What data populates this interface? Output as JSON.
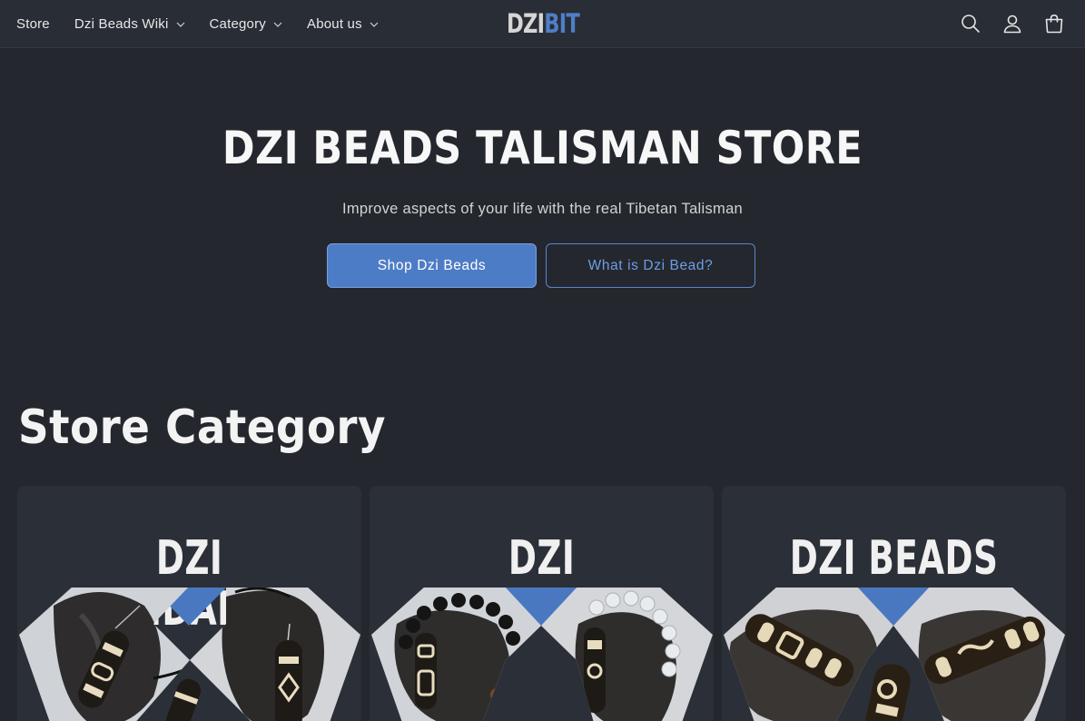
{
  "header": {
    "nav": [
      {
        "label": "Store",
        "has_dropdown": false
      },
      {
        "label": "Dzi Beads Wiki",
        "has_dropdown": true
      },
      {
        "label": "Category",
        "has_dropdown": true
      },
      {
        "label": "About us",
        "has_dropdown": true
      }
    ],
    "logo": {
      "part1": "DZI",
      "part2": "BIT"
    },
    "icons": [
      "search-icon",
      "account-icon",
      "cart-icon"
    ]
  },
  "hero": {
    "title": "DZI BEADS TALISMAN STORE",
    "subtitle": "Improve aspects of your life with the real Tibetan Talisman",
    "primary_button": "Shop Dzi Beads",
    "secondary_button": "What is Dzi Bead?"
  },
  "store_category": {
    "title": "Store Category",
    "cards": [
      {
        "title": "DZI PENDANTS"
      },
      {
        "title": "DZI BRACELETS"
      },
      {
        "title": "DZI BEADS"
      }
    ]
  },
  "colors": {
    "background": "#24272e",
    "header": "#292d35",
    "accent": "#4d7cc6",
    "card": "#2b2f37"
  }
}
